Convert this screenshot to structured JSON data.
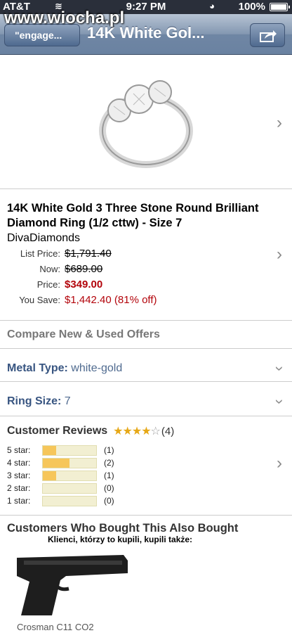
{
  "watermark": "www.wiocha.pl",
  "status": {
    "carrier": "AT&T",
    "time": "9:27 PM",
    "battery": "100%"
  },
  "nav": {
    "back": "\"engage...",
    "title": "14K White Gol..."
  },
  "product": {
    "title": "14K White Gold 3 Three Stone Round Brilliant Diamond Ring (1/2 cttw) - Size 7",
    "brand": "DivaDiamonds",
    "prices": [
      {
        "label": "List Price:",
        "value": "$1,791.40",
        "style": "strike"
      },
      {
        "label": "Now:",
        "value": "$689.00",
        "style": "strike"
      },
      {
        "label": "Price:",
        "value": "$349.00",
        "style": "price"
      },
      {
        "label": "You Save:",
        "value": "$1,442.40 (81% off)",
        "style": "save"
      }
    ]
  },
  "compare": "Compare New & Used Offers",
  "metal": {
    "label": "Metal Type:",
    "value": "white-gold"
  },
  "ring_size": {
    "label": "Ring Size:",
    "value": "7"
  },
  "reviews": {
    "title": "Customer Reviews",
    "rating": 4,
    "count": "(4)",
    "bars": [
      {
        "label": "5 star:",
        "count": "(1)",
        "fill": 0.25
      },
      {
        "label": "4 star:",
        "count": "(2)",
        "fill": 0.5
      },
      {
        "label": "3 star:",
        "count": "(1)",
        "fill": 0.25
      },
      {
        "label": "2 star:",
        "count": "(0)",
        "fill": 0
      },
      {
        "label": "1 star:",
        "count": "(0)",
        "fill": 0
      }
    ]
  },
  "also_bought": {
    "title": "Customers Who Bought This Also Bought",
    "caption": "Klienci, którzy to kupili, kupili także:",
    "item": "Crosman C11 CO2"
  },
  "colors": {
    "price_red": "#b3040b",
    "link_blue": "#385581",
    "star_gold": "#e6a817"
  }
}
